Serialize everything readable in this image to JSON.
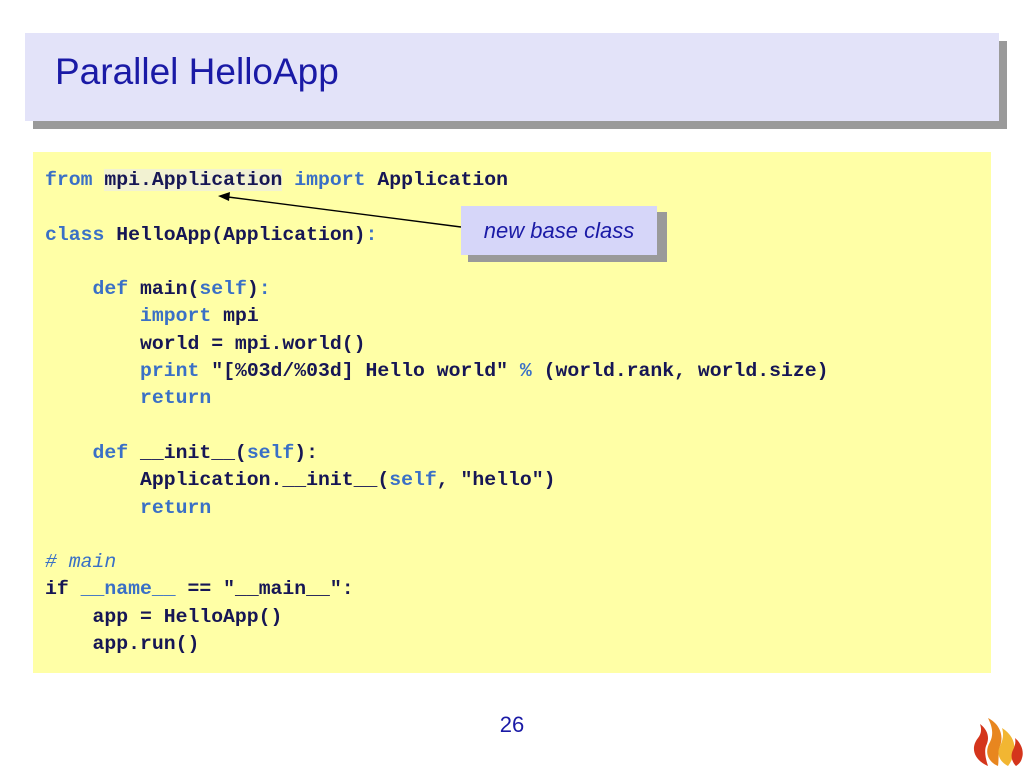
{
  "slide": {
    "title": "Parallel HelloApp",
    "page_number": "26"
  },
  "code": {
    "lines": [
      [
        {
          "t": "from ",
          "c": "kw"
        },
        {
          "t": "mpi.Application",
          "c": "hl"
        },
        {
          "t": " "
        },
        {
          "t": "import ",
          "c": "kw"
        },
        {
          "t": "Application"
        }
      ],
      [],
      [
        {
          "t": "class ",
          "c": "kw"
        },
        {
          "t": "HelloApp(Application)"
        },
        {
          "t": ":",
          "c": "kw"
        }
      ],
      [],
      [
        {
          "t": "    "
        },
        {
          "t": "def ",
          "c": "kw"
        },
        {
          "t": "main("
        },
        {
          "t": "self",
          "c": "kw"
        },
        {
          "t": ")"
        },
        {
          "t": ":",
          "c": "kw"
        }
      ],
      [
        {
          "t": "        "
        },
        {
          "t": "import ",
          "c": "kw"
        },
        {
          "t": "mpi"
        }
      ],
      [
        {
          "t": "        world = mpi.world()"
        }
      ],
      [
        {
          "t": "        "
        },
        {
          "t": "print ",
          "c": "kw"
        },
        {
          "t": "\"[%03d/%03d] Hello world\" "
        },
        {
          "t": "%",
          "c": "kw"
        },
        {
          "t": " (world.rank, world.size)"
        }
      ],
      [
        {
          "t": "        "
        },
        {
          "t": "return",
          "c": "kw"
        }
      ],
      [],
      [
        {
          "t": "    "
        },
        {
          "t": "def ",
          "c": "kw"
        },
        {
          "t": "__init__("
        },
        {
          "t": "self",
          "c": "kw"
        },
        {
          "t": "):"
        }
      ],
      [
        {
          "t": "        Application.__init__("
        },
        {
          "t": "self",
          "c": "kw"
        },
        {
          "t": ", \"hello\")"
        }
      ],
      [
        {
          "t": "        "
        },
        {
          "t": "return",
          "c": "kw"
        }
      ],
      [],
      [
        {
          "t": "# main",
          "c": "cm"
        }
      ],
      [
        {
          "t": "if "
        },
        {
          "t": "__name__",
          "c": "kw"
        },
        {
          "t": " == \"__main__\":"
        }
      ],
      [
        {
          "t": "    app = HelloApp()"
        }
      ],
      [
        {
          "t": "    app.run()"
        }
      ]
    ]
  },
  "callout": {
    "text": "new base class"
  },
  "colors": {
    "title_text": "#1a1aa6",
    "title_bg": "#e3e3f9",
    "code_bg": "#ffffa6",
    "keyword": "#3a70c6",
    "code_text": "#161655",
    "callout_bg": "#d6d6f9"
  },
  "icons": {
    "logo": "flame-logo-icon"
  }
}
